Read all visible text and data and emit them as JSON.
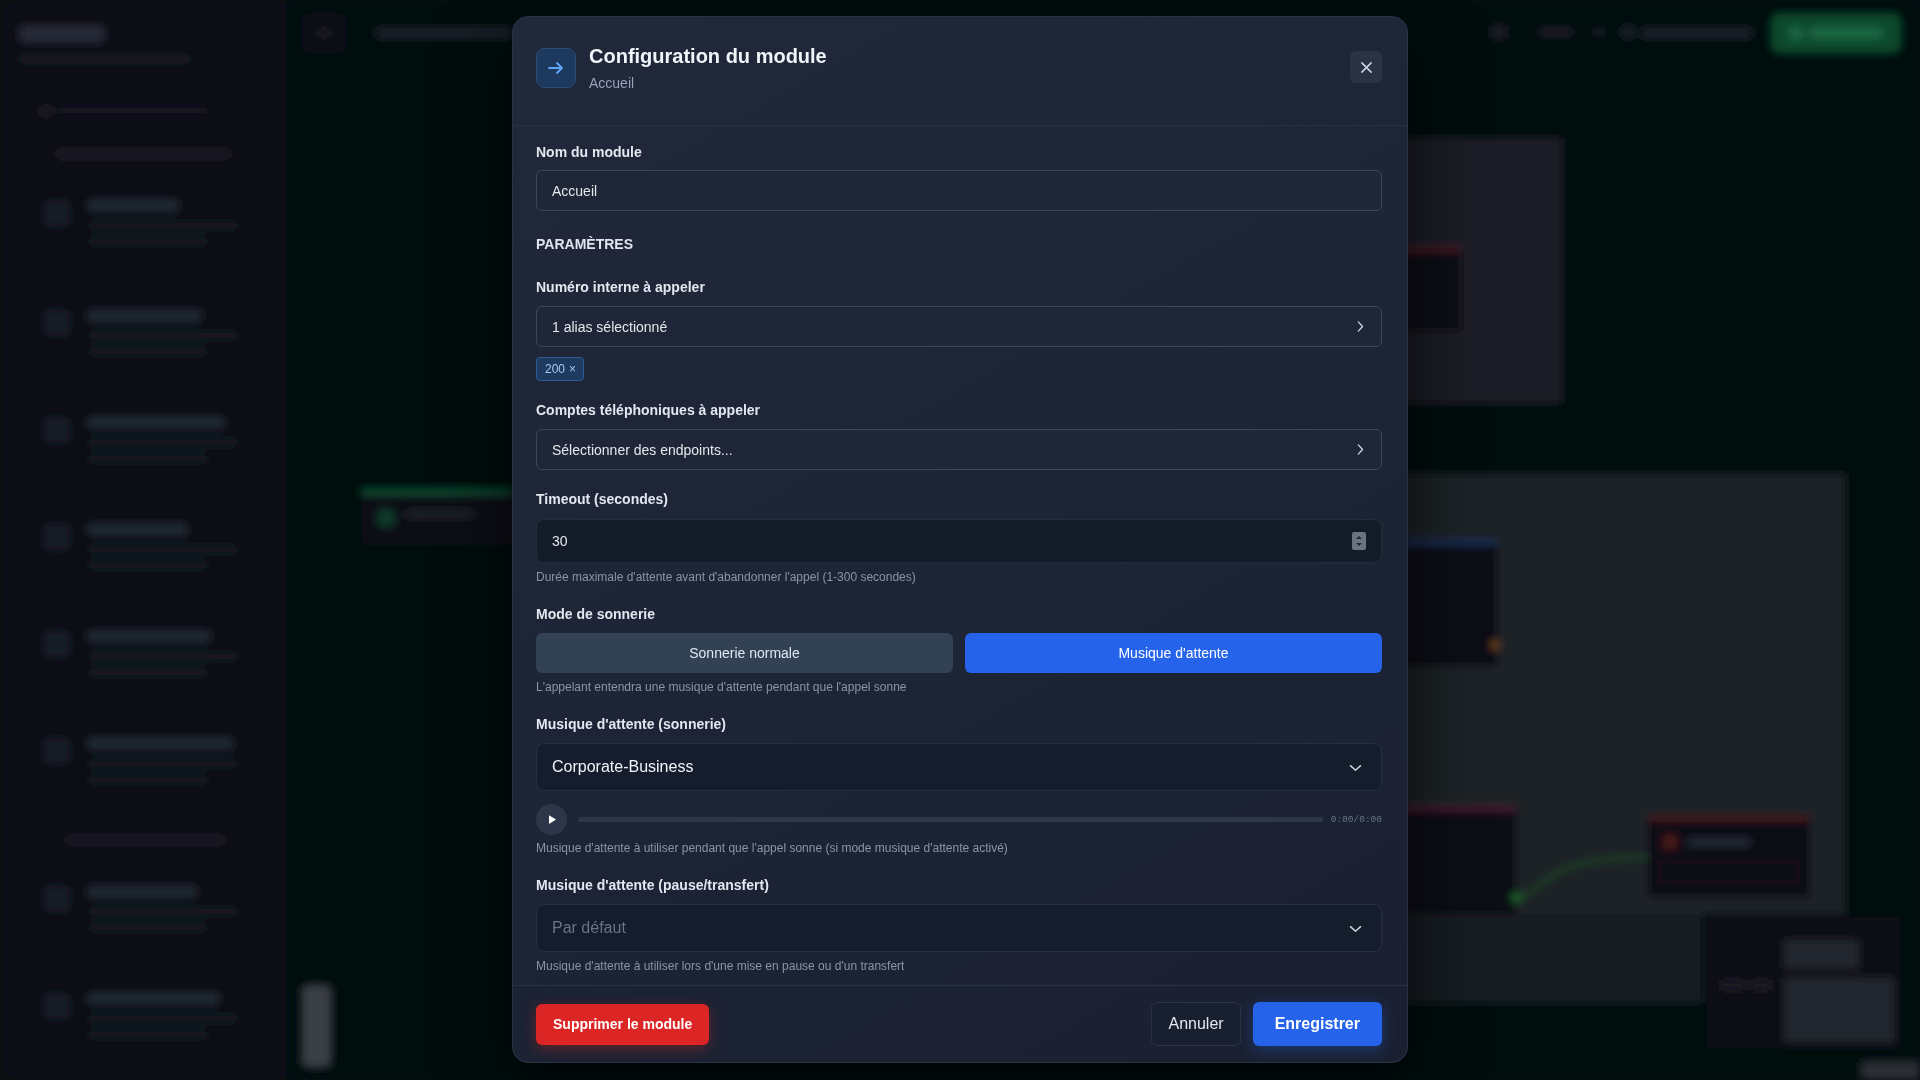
{
  "dialog": {
    "title": "Configuration du module",
    "subtitle": "Accueil"
  },
  "name_field": {
    "label": "Nom du module",
    "value": "Accueil"
  },
  "section_heading": "PARAMÈTRES",
  "parameters": [
    {
      "kind": "picker",
      "label": "Numéro interne à appeler",
      "value": "1 alias sélectionné",
      "tags": [
        {
          "label": "200",
          "remove": "×"
        }
      ]
    },
    {
      "kind": "picker",
      "label": "Comptes téléphoniques à appeler",
      "value": "Sélectionner des endpoints..."
    },
    {
      "kind": "number",
      "label": "Timeout (secondes)",
      "value": "30",
      "hint": "Durée maximale d'attente avant d'abandonner l'appel (1-300 secondes)"
    },
    {
      "kind": "segmented",
      "label": "Mode de sonnerie",
      "options": [
        {
          "label": "Sonnerie normale",
          "selected": false
        },
        {
          "label": "Musique d'attente",
          "selected": true
        }
      ],
      "hint": "L'appelant entendra une musique d'attente pendant que l'appel sonne"
    },
    {
      "kind": "dropdown",
      "label": "Musique d'attente (sonnerie)",
      "value": "Corporate-Business",
      "player": {
        "level": 0,
        "time": "0:00/0:00"
      },
      "hint": "Musique d'attente à utiliser pendant que l'appel sonne (si mode musique d'attente activé)"
    },
    {
      "kind": "dropdown",
      "label": "Musique d'attente (pause/transfert)",
      "placeholder": "Par défaut",
      "hint": "Musique d'attente à utiliser lors d'une mise en pause ou d'un transfert"
    }
  ],
  "footer": {
    "buttons": [
      {
        "kind": "danger",
        "label": "Supprimer le module"
      },
      {
        "kind": "secondary",
        "label": "Annuler"
      },
      {
        "kind": "primary",
        "label": "Enregistrer"
      }
    ]
  }
}
